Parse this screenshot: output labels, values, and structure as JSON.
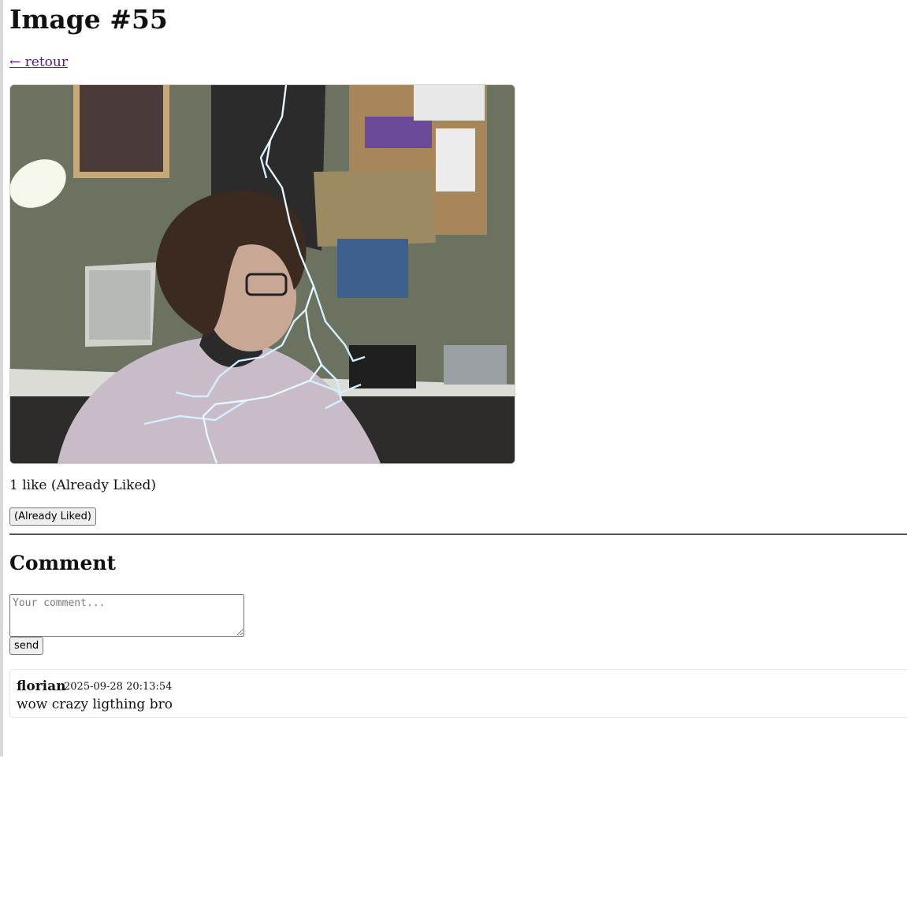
{
  "page": {
    "title": "Image #55",
    "back_link": "← retour"
  },
  "image": {
    "alt": "Photo of a person at a desk with a lightning effect"
  },
  "likes": {
    "status_text": "1 like (Already Liked)",
    "button_label": "(Already Liked)"
  },
  "comment_section": {
    "heading": "Comment",
    "input_placeholder": "Your comment...",
    "input_value": "",
    "send_label": "send"
  },
  "comments": [
    {
      "author": "florian",
      "timestamp": "2025-09-28 20:13:54",
      "text": "wow crazy ligthing bro"
    }
  ],
  "colors": {
    "link": "#551a8b",
    "lightning": "#cfe9ff"
  }
}
